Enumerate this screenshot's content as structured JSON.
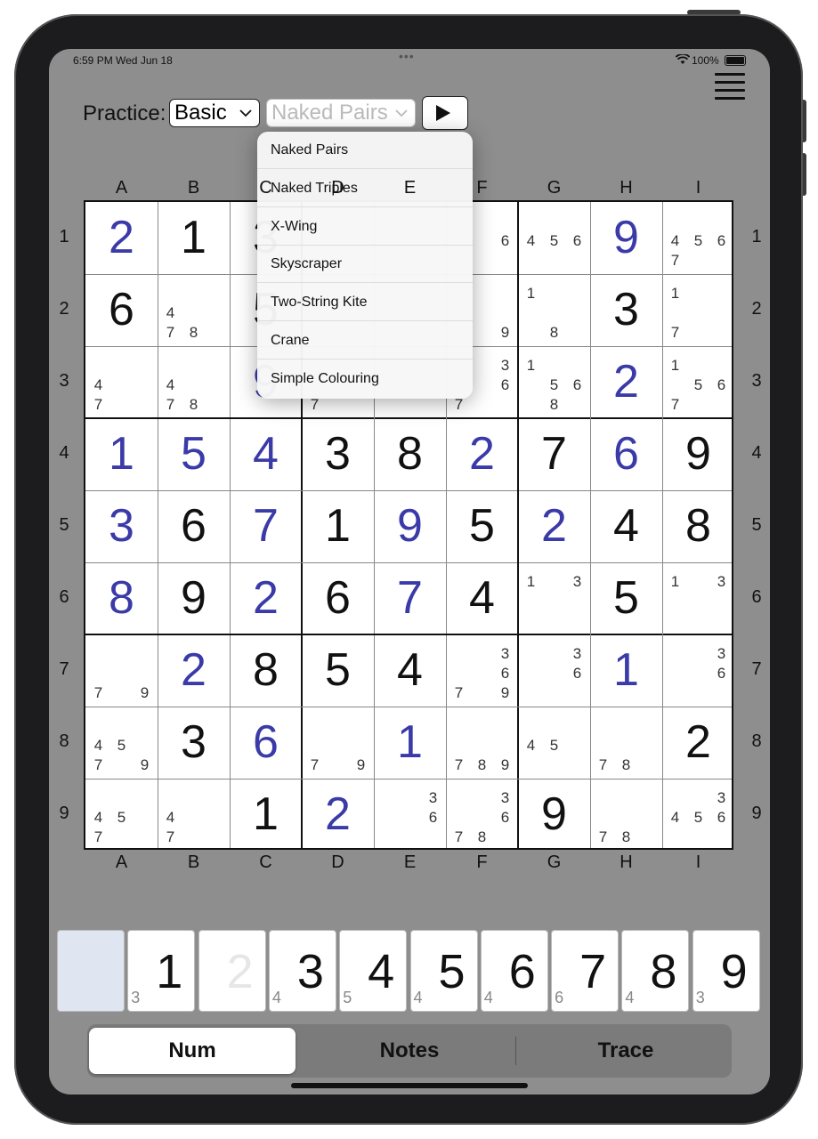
{
  "status_bar": {
    "time": "6:59 PM   Wed Jun 18",
    "dots": "•••",
    "battery": "100%",
    "icons": [
      "wifi-icon",
      "battery-icon"
    ]
  },
  "menu": {
    "icon": "hamburger-menu-icon"
  },
  "practice": {
    "label": "Practice:",
    "level": "Basic",
    "technique": "Naked Pairs",
    "play_icon": "play-icon"
  },
  "technique_menu": {
    "items": [
      "Naked Pairs",
      "Naked Triples",
      "X-Wing",
      "Skyscraper",
      "Two-String Kite",
      "Crane",
      "Simple Colouring"
    ]
  },
  "columns": [
    "A",
    "B",
    "C",
    "D",
    "E",
    "F",
    "G",
    "H",
    "I"
  ],
  "rows": [
    "1",
    "2",
    "3",
    "4",
    "5",
    "6",
    "7",
    "8",
    "9"
  ],
  "colors": {
    "user_digit": "#3a3aa8",
    "given_digit": "#111111",
    "background": "#8e8e8e"
  },
  "grid": [
    [
      {
        "v": "2",
        "t": "u"
      },
      {
        "v": "1",
        "t": "g"
      },
      {
        "v": "3",
        "t": "g"
      },
      {
        "n": []
      },
      {
        "n": []
      },
      {
        "n": [
          "6"
        ]
      },
      {
        "n": [
          "4",
          "5",
          "6"
        ]
      },
      {
        "v": "9",
        "t": "u"
      },
      {
        "n": [
          "4",
          "5",
          "6",
          "7"
        ]
      }
    ],
    [
      {
        "v": "6",
        "t": "g"
      },
      {
        "n": [
          "4",
          "7",
          "8"
        ]
      },
      {
        "v": "5",
        "t": "g"
      },
      {
        "n": []
      },
      {
        "n": []
      },
      {
        "n": [
          "9"
        ]
      },
      {
        "n": [
          "1",
          "8"
        ]
      },
      {
        "v": "3",
        "t": "g"
      },
      {
        "n": [
          "1",
          "7"
        ]
      }
    ],
    [
      {
        "n": [
          "4",
          "7"
        ]
      },
      {
        "n": [
          "4",
          "7",
          "8"
        ]
      },
      {
        "v": "9",
        "t": "u"
      },
      {
        "n": [
          "7"
        ]
      },
      {
        "n": []
      },
      {
        "n": [
          "3",
          "6",
          "7"
        ]
      },
      {
        "n": [
          "1",
          "5",
          "6",
          "8"
        ]
      },
      {
        "v": "2",
        "t": "u"
      },
      {
        "n": [
          "1",
          "5",
          "6",
          "7"
        ]
      }
    ],
    [
      {
        "v": "1",
        "t": "u"
      },
      {
        "v": "5",
        "t": "u"
      },
      {
        "v": "4",
        "t": "u"
      },
      {
        "v": "3",
        "t": "g"
      },
      {
        "v": "8",
        "t": "g"
      },
      {
        "v": "2",
        "t": "u"
      },
      {
        "v": "7",
        "t": "g"
      },
      {
        "v": "6",
        "t": "u"
      },
      {
        "v": "9",
        "t": "g"
      }
    ],
    [
      {
        "v": "3",
        "t": "u"
      },
      {
        "v": "6",
        "t": "g"
      },
      {
        "v": "7",
        "t": "u"
      },
      {
        "v": "1",
        "t": "g"
      },
      {
        "v": "9",
        "t": "u"
      },
      {
        "v": "5",
        "t": "g"
      },
      {
        "v": "2",
        "t": "u"
      },
      {
        "v": "4",
        "t": "g"
      },
      {
        "v": "8",
        "t": "g"
      }
    ],
    [
      {
        "v": "8",
        "t": "u"
      },
      {
        "v": "9",
        "t": "g"
      },
      {
        "v": "2",
        "t": "u"
      },
      {
        "v": "6",
        "t": "g"
      },
      {
        "v": "7",
        "t": "u"
      },
      {
        "v": "4",
        "t": "g"
      },
      {
        "n": [
          "1",
          "3"
        ]
      },
      {
        "v": "5",
        "t": "g"
      },
      {
        "n": [
          "1",
          "3"
        ]
      }
    ],
    [
      {
        "n": [
          "7",
          "9"
        ]
      },
      {
        "v": "2",
        "t": "u"
      },
      {
        "v": "8",
        "t": "g"
      },
      {
        "v": "5",
        "t": "g"
      },
      {
        "v": "4",
        "t": "g"
      },
      {
        "n": [
          "3",
          "6",
          "7",
          "9"
        ]
      },
      {
        "n": [
          "3",
          "6"
        ]
      },
      {
        "v": "1",
        "t": "u"
      },
      {
        "n": [
          "3",
          "6"
        ]
      }
    ],
    [
      {
        "n": [
          "4",
          "5",
          "7",
          "9"
        ]
      },
      {
        "v": "3",
        "t": "g"
      },
      {
        "v": "6",
        "t": "u"
      },
      {
        "n": [
          "7",
          "9"
        ]
      },
      {
        "v": "1",
        "t": "u"
      },
      {
        "n": [
          "7",
          "8",
          "9"
        ]
      },
      {
        "n": [
          "4",
          "5"
        ]
      },
      {
        "n": [
          "7",
          "8"
        ]
      },
      {
        "v": "2",
        "t": "g"
      }
    ],
    [
      {
        "n": [
          "4",
          "5",
          "7"
        ]
      },
      {
        "n": [
          "4",
          "7"
        ]
      },
      {
        "v": "1",
        "t": "g"
      },
      {
        "v": "2",
        "t": "u"
      },
      {
        "n": [
          "3",
          "6"
        ]
      },
      {
        "n": [
          "3",
          "6",
          "7",
          "8"
        ]
      },
      {
        "v": "9",
        "t": "g"
      },
      {
        "n": [
          "7",
          "8"
        ]
      },
      {
        "n": [
          "3",
          "4",
          "5",
          "6"
        ]
      }
    ]
  ],
  "numpad": [
    {
      "digit": "",
      "count": "",
      "state": "blank"
    },
    {
      "digit": "1",
      "count": "3",
      "state": "normal"
    },
    {
      "digit": "2",
      "count": "",
      "state": "dim"
    },
    {
      "digit": "3",
      "count": "4",
      "state": "normal"
    },
    {
      "digit": "4",
      "count": "5",
      "state": "normal"
    },
    {
      "digit": "5",
      "count": "4",
      "state": "normal"
    },
    {
      "digit": "6",
      "count": "4",
      "state": "normal"
    },
    {
      "digit": "7",
      "count": "6",
      "state": "normal"
    },
    {
      "digit": "8",
      "count": "4",
      "state": "normal"
    },
    {
      "digit": "9",
      "count": "3",
      "state": "normal"
    }
  ],
  "modes": {
    "options": [
      "Num",
      "Notes",
      "Trace"
    ],
    "selected": "Num"
  }
}
